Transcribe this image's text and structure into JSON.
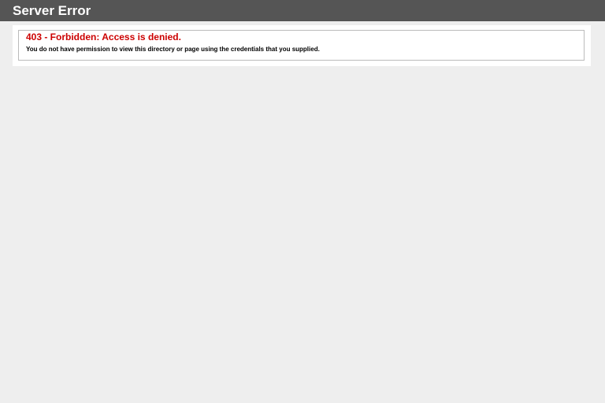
{
  "header": {
    "title": "Server Error"
  },
  "error": {
    "title": "403 - Forbidden: Access is denied.",
    "message": "You do not have permission to view this directory or page using the credentials that you supplied."
  },
  "colors": {
    "header_bg": "#555555",
    "page_bg": "#eeeeee",
    "error_title": "#cc0000"
  }
}
